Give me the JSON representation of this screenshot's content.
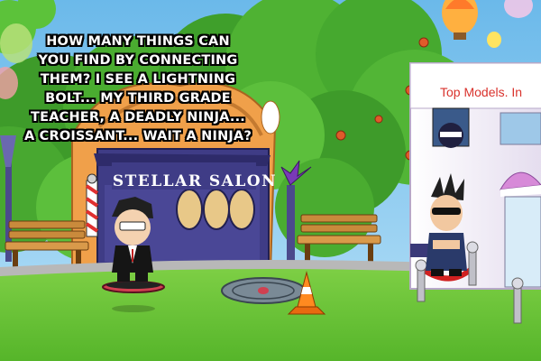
{
  "caption": {
    "lines": [
      "How many things can",
      "you find by connecting",
      "them?  I see a lightning",
      "bolt... my third grade",
      "teacher, a deadly ninja...",
      "a croissant... wait a ninja?"
    ]
  },
  "signs": {
    "salon": "STELLAR SALON",
    "models": "Top Models. In"
  },
  "colors": {
    "sky": "#7cc4ee",
    "grass": "#6cc93a",
    "salon_wall": "#3f3c86",
    "model_building": "#f4f0f8",
    "sign_red": "#d9322c"
  }
}
